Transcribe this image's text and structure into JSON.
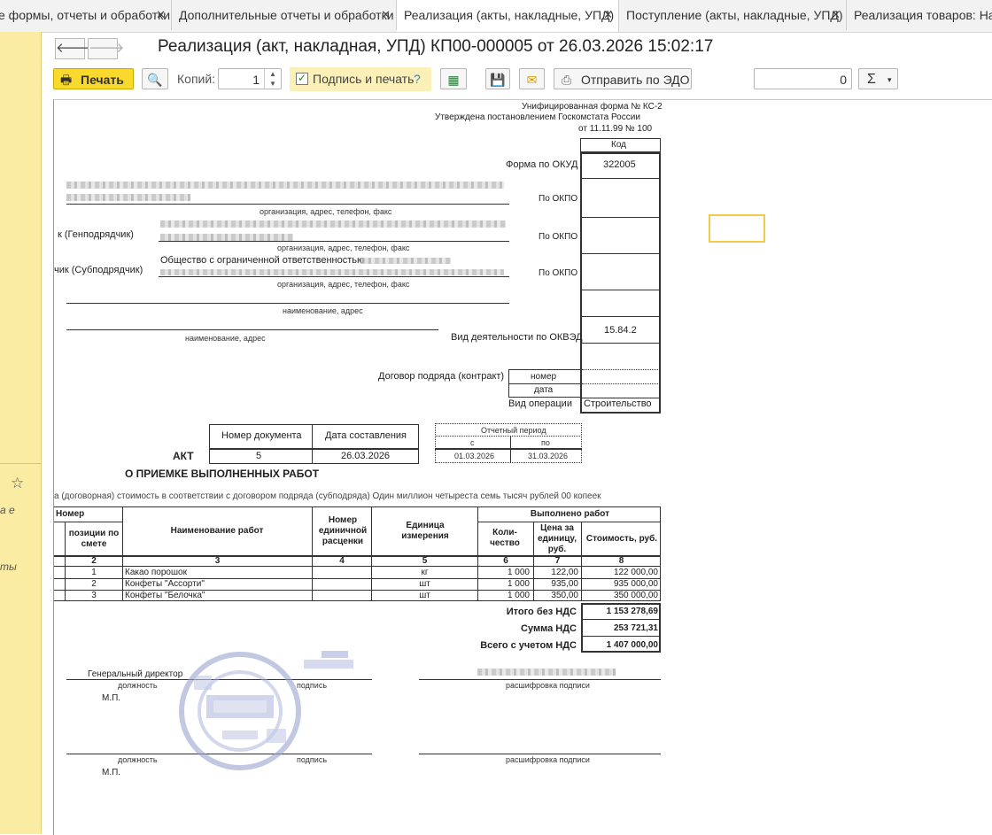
{
  "tabs": [
    {
      "label": "е формы, отчеты и обработки"
    },
    {
      "label": "Дополнительные отчеты и обработки"
    },
    {
      "label": "Реализация (акты, накладные, УПД)"
    },
    {
      "label": "Поступление (акты, накладные, УПД)"
    },
    {
      "label": "Реализация товаров: Накл"
    }
  ],
  "left_panel": {
    "text1": "а е",
    "text2": "ты"
  },
  "header": {
    "title": "Реализация (акт, накладная, УПД) КП00-000005 от 26.03.2026 15:02:17"
  },
  "toolbar": {
    "print_label": "Печать",
    "copies_label": "Копий:",
    "copies_value": "1",
    "sign_label": "Подпись и печать",
    "help": "?",
    "edo_label": "Отправить по ЭДО",
    "sum_value": "0",
    "sigma": "Σ"
  },
  "form": {
    "unified_form": "Унифицированная форма № КС-2",
    "approved": "Утверждена постановлением  Госкомстата России",
    "approved_date": "от 11.11.99 № 100",
    "code_header": "Код",
    "okud_label": "Форма по ОКУД",
    "okud_value": "322005",
    "okpo_label": "По ОКПО",
    "okved_label": "Вид деятельности по ОКВЭД",
    "okved_value": "15.84.2",
    "org_caption": "организация, адрес, телефон, факс",
    "name_caption": "наименование, адрес",
    "name_caption2": "наименование, адрес",
    "gen_label": "к (Генподрядчик)",
    "sub_label": "чик (Субподрядчик)",
    "sub_org": "Общество с ограниченной ответственностью",
    "contract_label": "Договор подряда (контракт)",
    "num_label": "номер",
    "date_label": "дата",
    "op_label": "Вид операции",
    "op_value": "Строительство",
    "doc_num_header": "Номер документа",
    "doc_date_header": "Дата составления",
    "act_label": "АКТ",
    "doc_num": "5",
    "doc_date": "26.03.2026",
    "period_label": "Отчетный период",
    "period_from_label": "с",
    "period_to_label": "по",
    "period_from": "01.03.2026",
    "period_to": "31.03.2026",
    "act_title": "О ПРИЕМКЕ ВЫПОЛНЕННЫХ РАБОТ",
    "cost_line": "а (договорная) стоимость в соответствии с договором подряда (субподряда) Один миллион четыреста семь тысяч рублей 00 копеек"
  },
  "table": {
    "h_number": "Номер",
    "h_pos": "позиции по смете",
    "h_name": "Наименование работ",
    "h_rate": "Номер единичной расценки",
    "h_unit": "Единица измерения",
    "h_done": "Выполнено работ",
    "h_qty": "Коли-чество",
    "h_price": "Цена за единицу, руб.",
    "h_cost": "Стоимость, руб.",
    "col_nums": [
      "2",
      "3",
      "4",
      "5",
      "6",
      "7",
      "8"
    ],
    "rows": [
      {
        "pos": "1",
        "name": "Какао порошок",
        "unit": "кг",
        "qty": "1 000",
        "price": "122,00",
        "cost": "122 000,00"
      },
      {
        "pos": "2",
        "name": "Конфеты \"Ассорти\"",
        "unit": "шт",
        "qty": "1 000",
        "price": "935,00",
        "cost": "935 000,00"
      },
      {
        "pos": "3",
        "name": "Конфеты \"Белочка\"",
        "unit": "шт",
        "qty": "1 000",
        "price": "350,00",
        "cost": "350 000,00"
      }
    ],
    "total_no_vat_label": "Итого без НДС",
    "total_no_vat": "1 153 278,69",
    "vat_label": "Сумма НДС",
    "vat": "253 721,31",
    "total_label": "Всего с учетом НДС",
    "total": "1 407 000,00"
  },
  "signatures": {
    "position": "Генеральный директор",
    "position_caption": "должность",
    "signature_caption": "подпись",
    "decode_caption": "расшифровка подписи",
    "mp": "М.П."
  }
}
